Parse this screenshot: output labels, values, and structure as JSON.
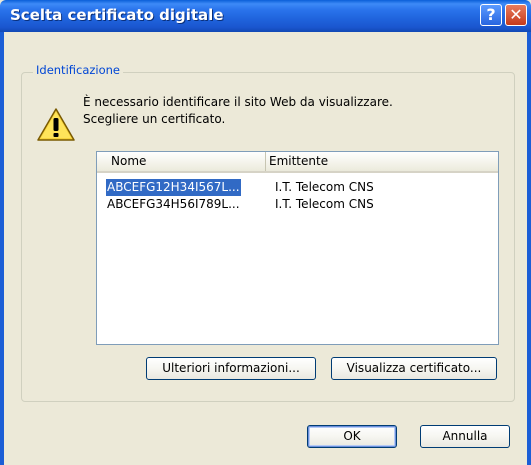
{
  "window": {
    "title": "Scelta certificato digitale",
    "help_glyph": "?",
    "close_glyph": "✕"
  },
  "group": {
    "label": "Identificazione"
  },
  "message": {
    "line1": "È necessario identificare il sito Web da visualizzare.",
    "line2": "Scegliere un certificato."
  },
  "list": {
    "columns": [
      "Nome",
      "Emittente"
    ],
    "rows": [
      {
        "nome": "ABCEFG12H34I567L...",
        "emittente": "I.T. Telecom CNS",
        "selected": true
      },
      {
        "nome": "ABCEFG34H56I789L...",
        "emittente": "I.T. Telecom CNS",
        "selected": false
      }
    ]
  },
  "buttons": {
    "more_info": "Ulteriori informazioni...",
    "view_cert": "Visualizza certificato...",
    "ok": "OK",
    "cancel": "Annulla"
  },
  "colors": {
    "title_bar": "#1f63dc",
    "dialog_bg": "#ece9d8",
    "selection": "#316ac5",
    "group_label": "#0046d5"
  }
}
